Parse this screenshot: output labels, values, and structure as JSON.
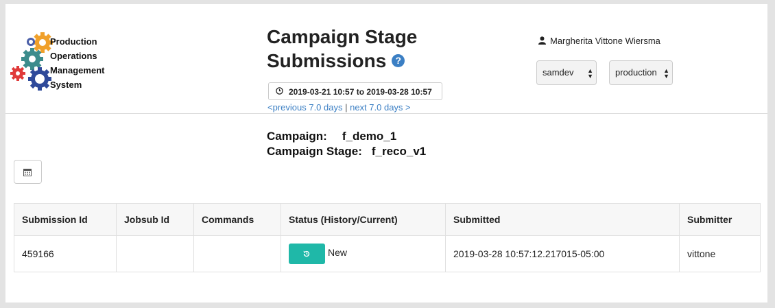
{
  "logo": {
    "line1": "Production",
    "line2": "Operations",
    "line3": "Management",
    "line4": "System"
  },
  "header": {
    "title": "Campaign Stage Submissions",
    "help_icon": "question-circle-icon",
    "date_range": "2019-03-21 10:57 to 2019-03-28 10:57",
    "prev_link": "<previous 7.0 days",
    "separator": " | ",
    "next_link": "next 7.0 days >",
    "user_name": "Margherita Vittone Wiersma",
    "experiment_select": "samdev",
    "role_select": "production"
  },
  "campaign": {
    "campaign_label": "Campaign:",
    "campaign_value": "f_demo_1",
    "stage_label": "Campaign Stage:",
    "stage_value": "f_reco_v1"
  },
  "table": {
    "headers": [
      "Submission Id",
      "Jobsub Id",
      "Commands",
      "Status (History/Current)",
      "Submitted",
      "Submitter"
    ],
    "rows": [
      {
        "submission_id": "459166",
        "jobsub_id": "",
        "commands": "",
        "status": "New",
        "submitted": "2019-03-28 10:57:12.217015-05:00",
        "submitter": "vittone"
      }
    ]
  },
  "colors": {
    "accent": "#3b7fc4",
    "status_button": "#1fb8a8"
  }
}
